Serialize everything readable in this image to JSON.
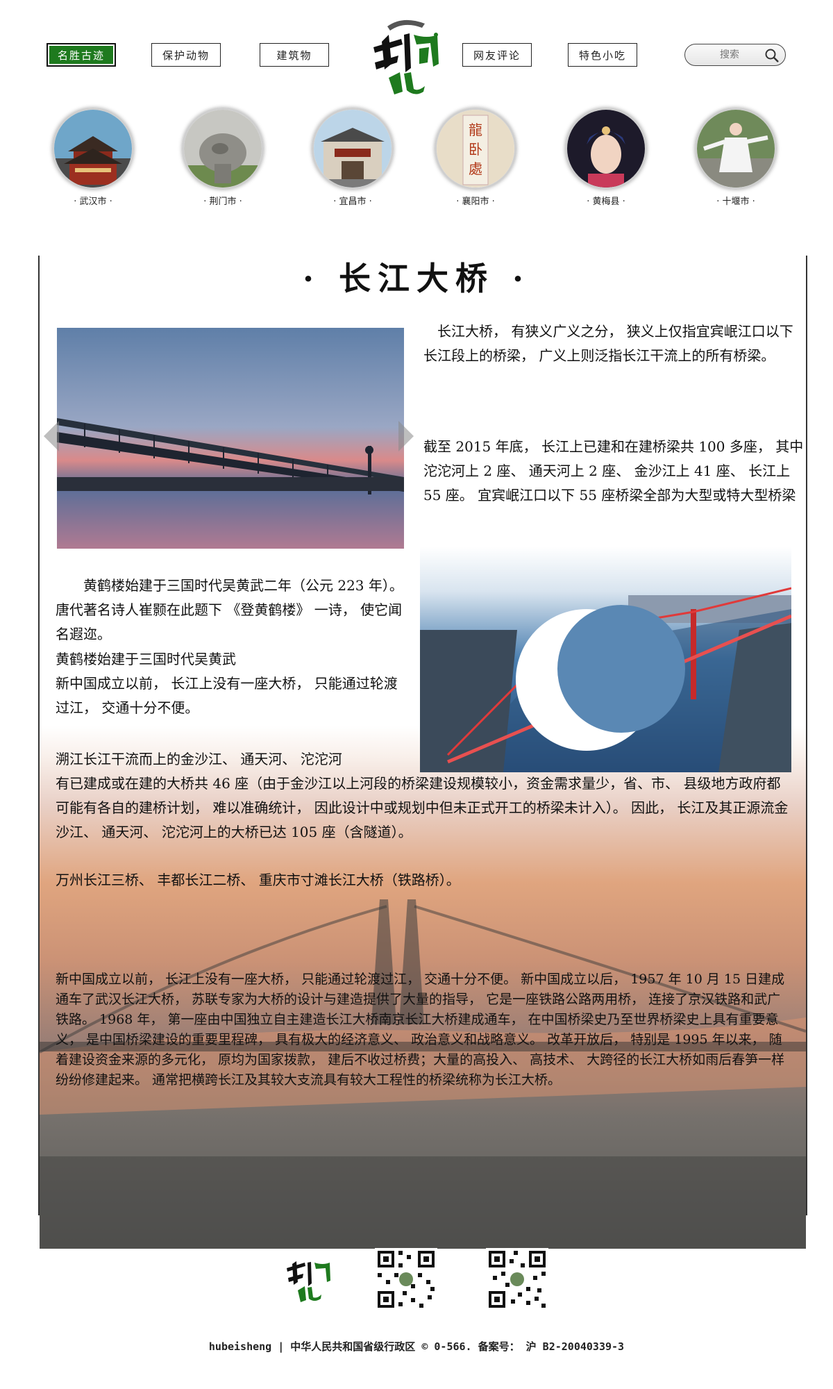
{
  "nav": {
    "items": [
      {
        "label": "名胜古迹"
      },
      {
        "label": "保护动物"
      },
      {
        "label": "建筑物"
      },
      {
        "label": "网友评论"
      },
      {
        "label": "特色小吃"
      }
    ],
    "search_placeholder": "搜索",
    "logo_text": "到湖北"
  },
  "cities": [
    {
      "label": "· 武汉市 ·"
    },
    {
      "label": "· 荆门市 ·"
    },
    {
      "label": "· 宜昌市 ·"
    },
    {
      "label": "· 襄阳市 ·"
    },
    {
      "label": "· 黄梅县 ·"
    },
    {
      "label": "· 十堰市 ·"
    }
  ],
  "article": {
    "title": "· 长江大桥 ·",
    "p1": "长江大桥， 有狭义广义之分， 狭义上仅指宜宾岷江口以下长江段上的桥梁， 广义上则泛指长江干流上的所有桥梁。",
    "p2": "截至 2015 年底， 长江上已建和在建桥梁共 100 多座， 其中沱沱河上 2 座、 通天河上 2 座、 金沙江上 41 座、 长江上 55 座。 宜宾岷江口以下 55 座桥梁全部为大型或特大型桥梁",
    "p3_lines": [
      "黄鹤楼始建于三国时代吴黄武二年（公元 223 年）。 唐代著名诗人崔颢在此题下 《登黄鹤楼》 一诗， 使它闻名遐迩。",
      "黄鹤楼始建于三国时代吴黄武",
      "新中国成立以前， 长江上没有一座大桥， 只能通过轮渡过江， 交通十分不便。"
    ],
    "p4_line1": "溯江长江干流而上的金沙江、 通天河、 沱沱河",
    "p4_rest": "有已建成或在建的大桥共 46 座（由于金沙江以上河段的桥梁建设规模较小，资金需求量少，省、市、 县级地方政府都可能有各自的建桥计划， 难以准确统计， 因此设计中或规划中但未正式开工的桥梁未计入）。 因此， 长江及其正源流金沙江、 通天河、 沱沱河上的大桥已达 105 座（含隧道）。",
    "p5": "万州长江三桥、 丰都长江二桥、 重庆市寸滩长江大桥（铁路桥）。",
    "p6": "新中国成立以前， 长江上没有一座大桥， 只能通过轮渡过江， 交通十分不便。 新中国成立以后， 1957 年 10 月 15 日建成通车了武汉长江大桥， 苏联专家为大桥的设计与建造提供了大量的指导， 它是一座铁路公路两用桥， 连接了京汉铁路和武广铁路。 1968 年， 第一座由中国独立自主建造长江大桥南京长江大桥建成通车， 在中国桥梁史乃至世界桥梁史上具有重要意义， 是中国桥梁建设的重要里程碑， 具有极大的经济意义、 政治意义和战略意义。 改革开放后， 特别是 1995 年以来， 随着建设资金来源的多元化， 原均为国家拨款， 建后不收过桥费；大量的高投入、 高技术、 大跨径的长江大桥如雨后春笋一样纷纷修建起来。 通常把横跨长江及其较大支流具有较大工程性的桥梁统称为长江大桥。"
  },
  "footer": {
    "logo_text": "到湖北",
    "text": "hubeisheng | 中华人民共和国省级行政区 © 0-566. 备案号： 沪 B2-20040339-3"
  },
  "colors": {
    "accent_green": "#1e7a1e",
    "border": "#222222"
  }
}
